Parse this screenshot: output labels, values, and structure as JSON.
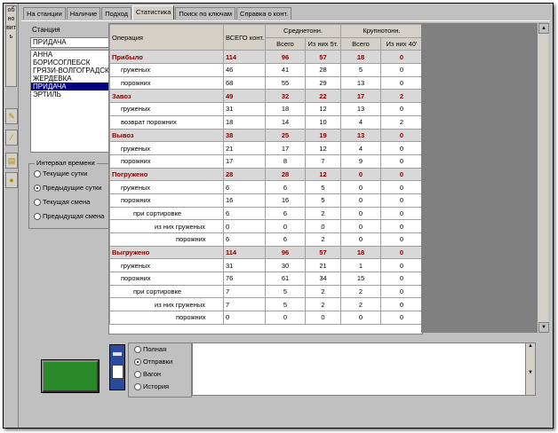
{
  "sidebar": {
    "vertical_label": "обновить"
  },
  "tabs": [
    "На станции",
    "Наличие",
    "Подход",
    "Статистика",
    "Поиск по ключам",
    "Справка о конт."
  ],
  "active_tab": "Статистика",
  "station": {
    "label": "Станция",
    "value": "ПРИДАЧА",
    "list": [
      "АННА",
      "БОРИСОГЛЕБСК",
      "ГРЯЗИ-ВОЛГОГРАДСКИЕ",
      "ЖЕРДЕВКА",
      "ПРИДАЧА",
      "ЭРТИЛЬ"
    ],
    "selected": "ПРИДАЧА"
  },
  "interval": {
    "legend": "Интервал времени",
    "options": [
      "Текущие сутки",
      "Предыдущие сутки",
      "Текущая смена",
      "Предыдущая смена"
    ],
    "selected": "Предыдущие сутки"
  },
  "table": {
    "header": {
      "operation": "Операция",
      "total": "ВСЕГО конт.",
      "medium": "Среднетонн.",
      "large": "Крупнотонн.",
      "sub_total": "Всего",
      "sub_medium_5t": "Из них 5т.",
      "sub_total2": "Всего",
      "sub_large_40": "Из них 40'"
    },
    "rows": [
      {
        "label": "Прибыло",
        "cat": true,
        "level": 0,
        "total": "114",
        "med": "96",
        "med5": "57",
        "large": "18",
        "large40": "0"
      },
      {
        "label": "груженых",
        "cat": false,
        "level": 1,
        "total": "46",
        "med": "41",
        "med5": "28",
        "large": "5",
        "large40": "0"
      },
      {
        "label": "порожних",
        "cat": false,
        "level": 1,
        "total": "68",
        "med": "55",
        "med5": "29",
        "large": "13",
        "large40": "0"
      },
      {
        "label": "Завоз",
        "cat": true,
        "level": 0,
        "total": "49",
        "med": "32",
        "med5": "22",
        "large": "17",
        "large40": "2"
      },
      {
        "label": "груженых",
        "cat": false,
        "level": 1,
        "total": "31",
        "med": "18",
        "med5": "12",
        "large": "13",
        "large40": "0"
      },
      {
        "label": "возврат порожних",
        "cat": false,
        "level": 1,
        "total": "18",
        "med": "14",
        "med5": "10",
        "large": "4",
        "large40": "2"
      },
      {
        "label": "Вывоз",
        "cat": true,
        "level": 0,
        "total": "38",
        "med": "25",
        "med5": "19",
        "large": "13",
        "large40": "0"
      },
      {
        "label": "груженых",
        "cat": false,
        "level": 1,
        "total": "21",
        "med": "17",
        "med5": "12",
        "large": "4",
        "large40": "0"
      },
      {
        "label": "порожних",
        "cat": false,
        "level": 1,
        "total": "17",
        "med": "8",
        "med5": "7",
        "large": "9",
        "large40": "0"
      },
      {
        "label": "Погружено",
        "cat": true,
        "level": 0,
        "total": "28",
        "med": "28",
        "med5": "12",
        "large": "0",
        "large40": "0"
      },
      {
        "label": "груженых",
        "cat": false,
        "level": 1,
        "total": "6",
        "med": "6",
        "med5": "5",
        "large": "0",
        "large40": "0"
      },
      {
        "label": "порожних",
        "cat": false,
        "level": 1,
        "total": "16",
        "med": "16",
        "med5": "5",
        "large": "0",
        "large40": "0"
      },
      {
        "label": "при сортировке",
        "cat": false,
        "level": 2,
        "total": "6",
        "med": "6",
        "med5": "2",
        "large": "0",
        "large40": "0"
      },
      {
        "label": "из них груженых",
        "cat": false,
        "level": 3,
        "total": "0",
        "med": "0",
        "med5": "0",
        "large": "0",
        "large40": "0"
      },
      {
        "label": "порожних",
        "cat": false,
        "level": 4,
        "total": "6",
        "med": "6",
        "med5": "2",
        "large": "0",
        "large40": "0"
      },
      {
        "label": "Выгружено",
        "cat": true,
        "level": 0,
        "total": "114",
        "med": "96",
        "med5": "57",
        "large": "18",
        "large40": "0"
      },
      {
        "label": "груженых",
        "cat": false,
        "level": 1,
        "total": "31",
        "med": "30",
        "med5": "21",
        "large": "1",
        "large40": "0"
      },
      {
        "label": "порожних",
        "cat": false,
        "level": 1,
        "total": "76",
        "med": "61",
        "med5": "34",
        "large": "15",
        "large40": "0"
      },
      {
        "label": "при сортировке",
        "cat": false,
        "level": 2,
        "total": "7",
        "med": "5",
        "med5": "2",
        "large": "2",
        "large40": "0"
      },
      {
        "label": "из них груженых",
        "cat": false,
        "level": 3,
        "total": "7",
        "med": "5",
        "med5": "2",
        "large": "2",
        "large40": "0"
      },
      {
        "label": "порожних",
        "cat": false,
        "level": 4,
        "total": "0",
        "med": "0",
        "med5": "0",
        "large": "0",
        "large40": "0"
      }
    ]
  },
  "report_mode": {
    "options": [
      "Полная",
      "Отправки",
      "Вагон",
      "История"
    ],
    "selected": "Отправки"
  },
  "colors": {
    "category_text": "#800000",
    "selection": "#000080",
    "button_bg": "#2a8a2a"
  }
}
